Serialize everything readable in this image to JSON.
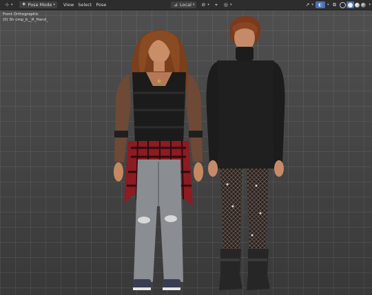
{
  "header": {
    "mode": "Pose Mode",
    "menu": [
      "View",
      "Select",
      "Pose"
    ],
    "transform_orientation": "Local"
  },
  "overlay": {
    "view_name": "Front Orthographic",
    "object_info": "(0) Sh cmp_b__R_Hand_"
  },
  "icons": [
    "editor-type-icon",
    "pose-mode-icon",
    "orientation-icon",
    "pivot-icon",
    "snap-icon",
    "proportional-icon",
    "overlay-icon",
    "gizmo-icon",
    "xray-icon",
    "wireframe-shading-icon",
    "solid-shading-icon",
    "material-shading-icon",
    "rendered-shading-icon"
  ],
  "colors": {
    "header_bg": "#2d2d2d",
    "viewport_bg": "#464646",
    "accent_blue": "#4772b3"
  }
}
